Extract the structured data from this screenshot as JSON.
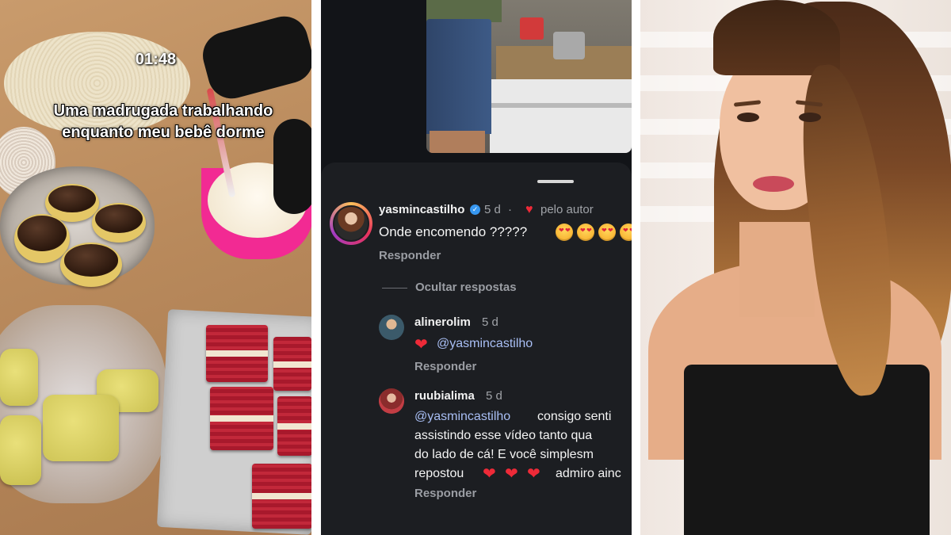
{
  "video": {
    "timer": "01:48",
    "caption": "Uma madrugada trabalhando enquanto meu bebê dorme"
  },
  "comments": {
    "main": {
      "username": "yasmincastilho",
      "time": "5 d",
      "separator": "·",
      "liked_by_author": "pelo autor",
      "text": "Onde encomendo ?????",
      "reply_label": "Responder",
      "hide_replies_label": "Ocultar respostas"
    },
    "replies": [
      {
        "username": "alinerolim",
        "time": "5 d",
        "mention": "@yasmincastilho",
        "reply_label": "Responder"
      },
      {
        "username": "ruubialima",
        "time": "5 d",
        "mention": "@yasmincastilho",
        "line1_text": "consigo senti",
        "line2": "assistindo esse vídeo tanto qua",
        "line3": "do lado de cá! E você simplesm",
        "line4_start": "repostou",
        "line4_end": "admiro ainc",
        "reply_label": "Responder"
      }
    ]
  },
  "icons": {
    "verified": "verified-badge-icon",
    "liked": "heart-icon",
    "emoji": "heart-eyes-emoji-icon"
  },
  "colors": {
    "mention_blue": "#a9bff5",
    "heart_red": "#ee2a38",
    "verified_blue": "#3797f0",
    "comment_bg": "#1c1e22"
  }
}
